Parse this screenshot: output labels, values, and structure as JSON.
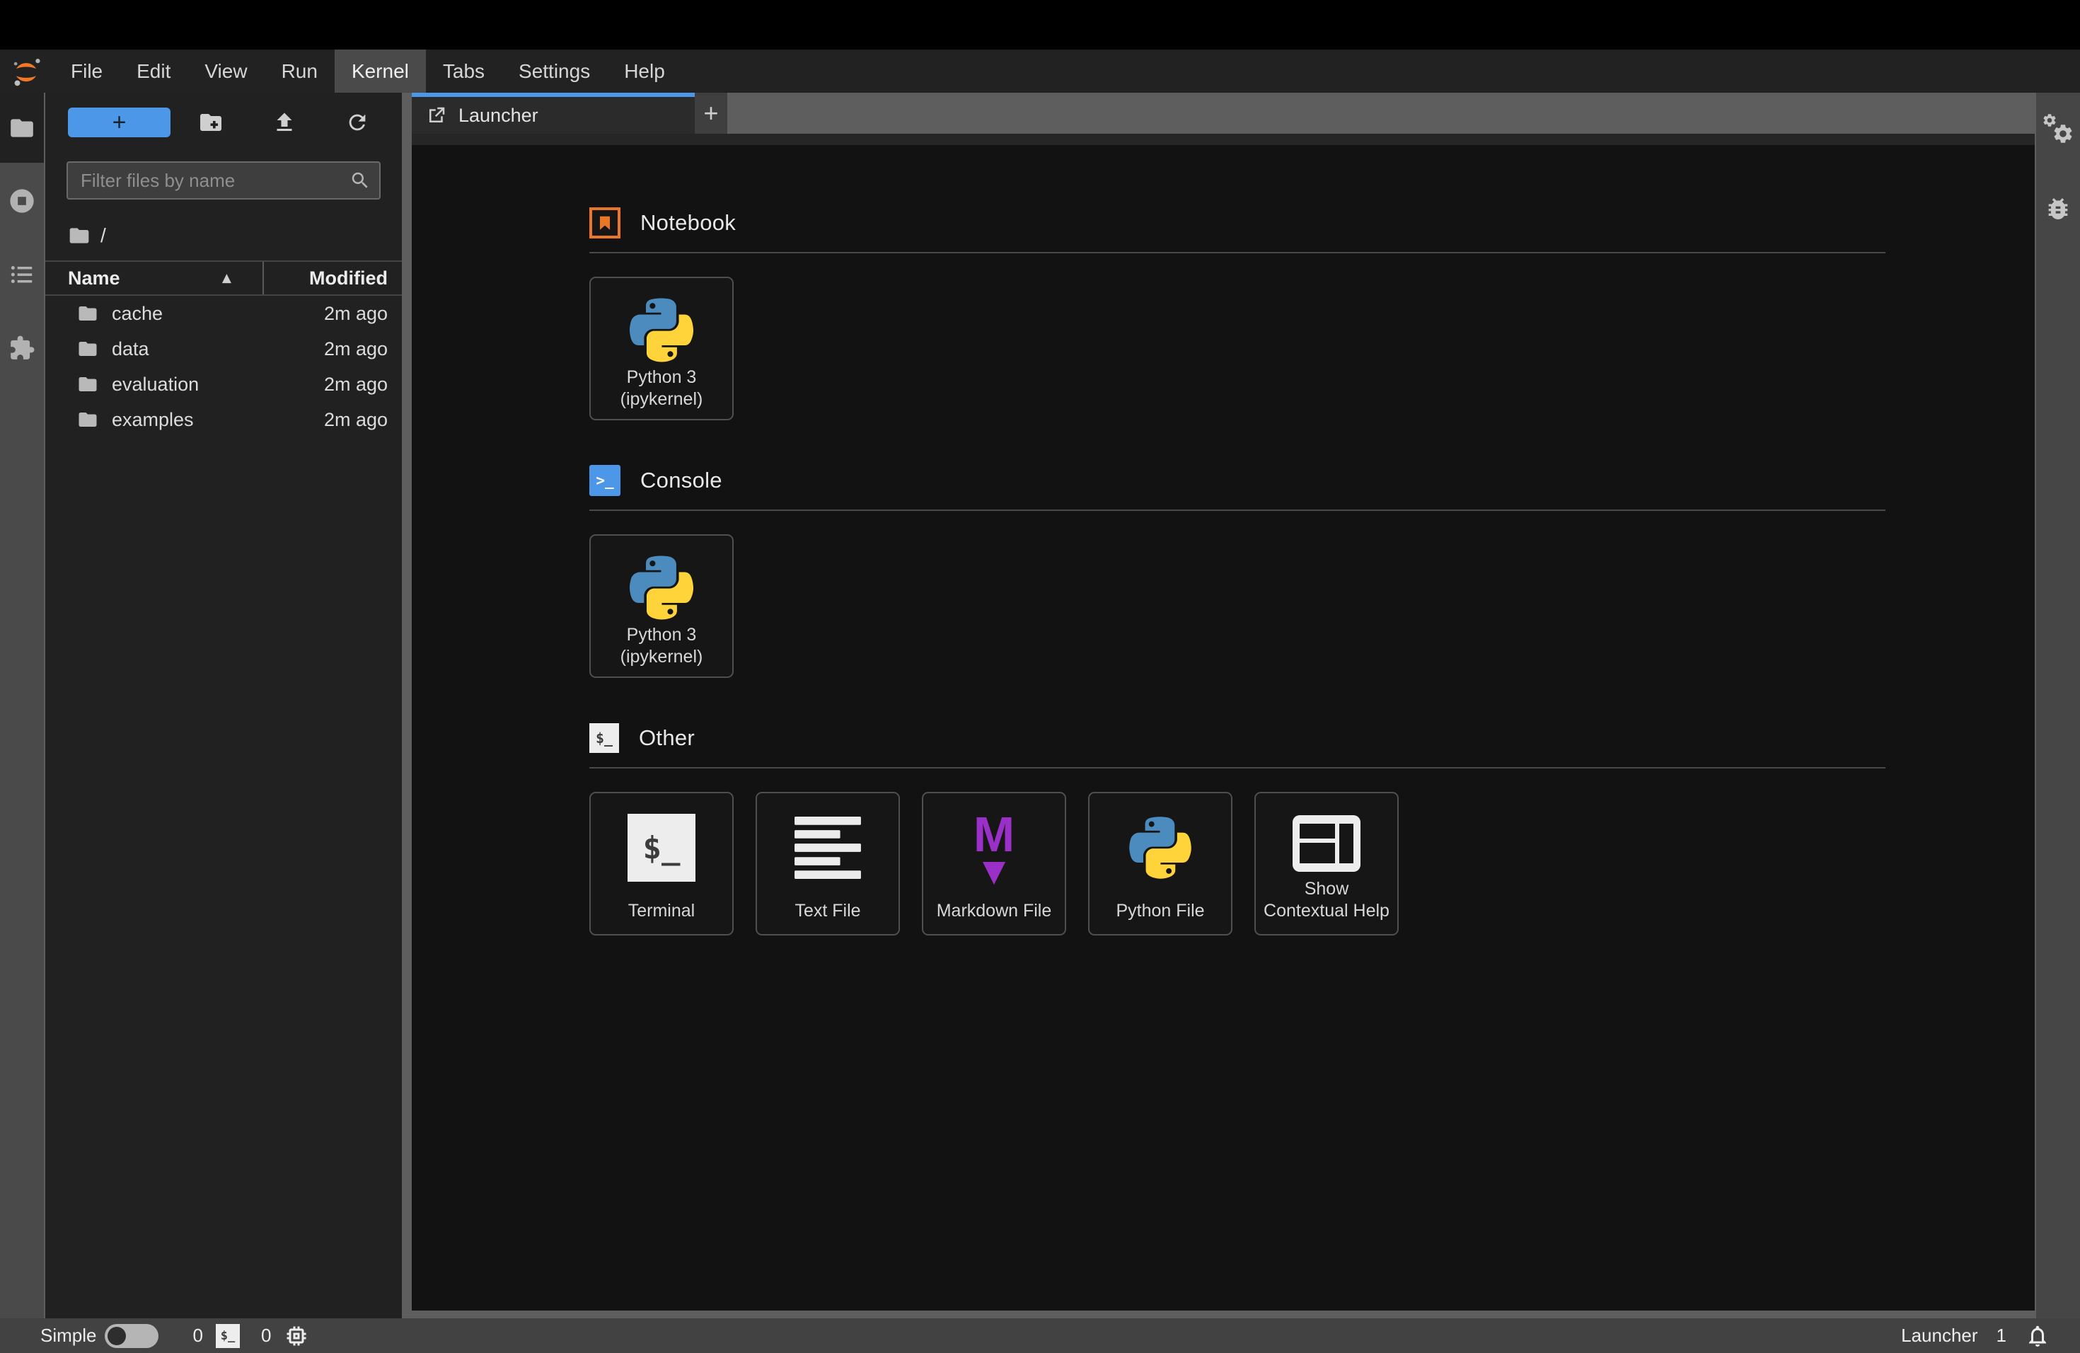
{
  "menu_bar": {
    "items": [
      {
        "label": "File"
      },
      {
        "label": "Edit"
      },
      {
        "label": "View"
      },
      {
        "label": "Run"
      },
      {
        "label": "Kernel",
        "active": true
      },
      {
        "label": "Tabs"
      },
      {
        "label": "Settings"
      },
      {
        "label": "Help"
      }
    ]
  },
  "file_browser": {
    "new_launcher_button": "+",
    "filter": {
      "placeholder": "Filter files by name"
    },
    "breadcrumb": {
      "root": "/"
    },
    "header": {
      "name": "Name",
      "modified": "Modified",
      "sort_indicator": "▲"
    },
    "files": [
      {
        "name": "cache",
        "modified": "2m ago"
      },
      {
        "name": "data",
        "modified": "2m ago"
      },
      {
        "name": "evaluation",
        "modified": "2m ago"
      },
      {
        "name": "examples",
        "modified": "2m ago"
      }
    ]
  },
  "dock": {
    "tabs": [
      {
        "label": "Launcher",
        "active": true
      }
    ],
    "add_tab_label": "+"
  },
  "launcher": {
    "sections": [
      {
        "title": "Notebook",
        "cards": [
          {
            "line1": "Python 3",
            "line2": "(ipykernel)"
          }
        ]
      },
      {
        "title": "Console",
        "cards": [
          {
            "line1": "Python 3",
            "line2": "(ipykernel)"
          }
        ]
      },
      {
        "title": "Other",
        "cards": [
          {
            "line1": "Terminal"
          },
          {
            "line1": "Text File"
          },
          {
            "line1": "Markdown File"
          },
          {
            "line1": "Python File"
          },
          {
            "line1": "Show",
            "line2": "Contextual Help"
          }
        ]
      }
    ]
  },
  "status_bar": {
    "simple_label": "Simple",
    "terminal_count": "0",
    "kernel_count": "0",
    "current_context": "Launcher",
    "notification_count": "1"
  },
  "icons": {
    "jupyter-logo": "orange double-crescent with gray dots",
    "folder-icon": "folder glyph",
    "new-folder-icon": "folder with plus",
    "upload-icon": "arrow up over tray",
    "refresh-icon": "circular arrow",
    "search-icon": "magnifier",
    "running-icon": "stop circle",
    "toc-icon": "bulleted list",
    "extensions-icon": "puzzle piece",
    "external-launcher-icon": "square with outward arrow",
    "notebook-icon": "orange framed bookmark",
    "console-icon": "blue prompt >_",
    "terminal-icon": "white box $_",
    "text-file-icon": "stacked text lines",
    "markdown-icon": "purple M with down arrow",
    "python-logo": "blue and yellow snakes",
    "contextual-help-icon": "panel layout",
    "gears-icon": "two gears",
    "bug-icon": "debugger bug",
    "chip-icon": "kernel chip",
    "bell-icon": "notification bell"
  },
  "colors": {
    "accent_blue": "#4d97e8",
    "jupyter_orange": "#f37726",
    "markdown_purple": "#9b30c8",
    "python_blue": "#4b8bbe",
    "python_yellow": "#ffd43b"
  }
}
